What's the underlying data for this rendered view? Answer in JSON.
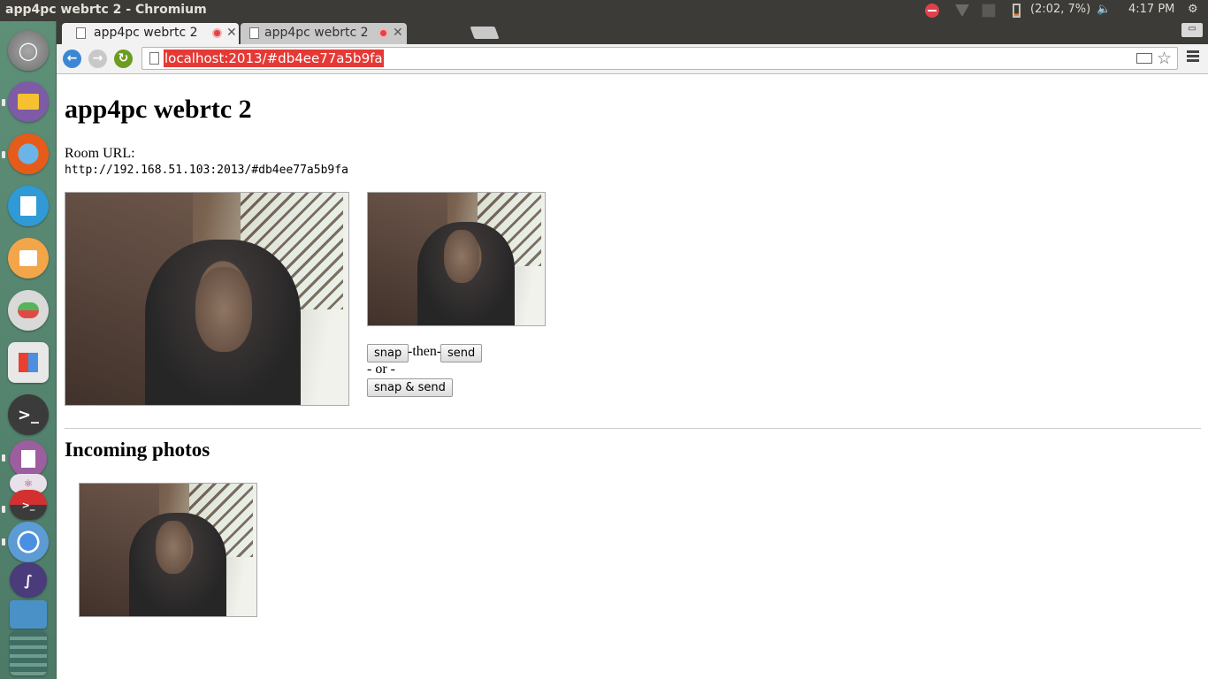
{
  "system": {
    "window_title": "app4pc webrtc 2 - Chromium",
    "battery": "(2:02, 7%)",
    "clock": "4:17 PM"
  },
  "launcher": {
    "apps": [
      "ubuntu-dash",
      "files",
      "firefox",
      "libreoffice-writer",
      "ubuntu-software-center",
      "system-settings",
      "unity-tweak",
      "terminal",
      "text-editor",
      "atom",
      "terminal-2",
      "chromium",
      "emacs",
      "workspaces"
    ]
  },
  "browser": {
    "tabs": [
      {
        "label": "app4pc webrtc 2",
        "active": true
      },
      {
        "label": "app4pc webrtc 2",
        "active": false
      }
    ],
    "url": "localhost:2013/#db4ee77a5b9fa"
  },
  "page": {
    "title": "app4pc webrtc 2",
    "room_label": "Room URL:",
    "room_url": "http://192.168.51.103:2013/#db4ee77a5b9fa",
    "snap_label": "snap",
    "then_text": "-then-",
    "send_label": "send",
    "or_text": "- or -",
    "snap_send_label": "snap & send",
    "incoming_title": "Incoming photos"
  },
  "colors": {
    "launcher_bg": "#5e8f77",
    "panel_bg": "#3c3b37",
    "url_highlight": "#e53935"
  }
}
